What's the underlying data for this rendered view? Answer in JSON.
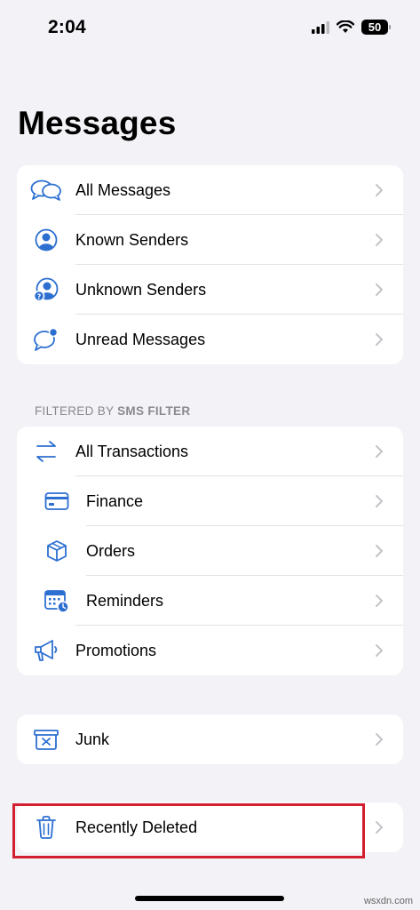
{
  "status_bar": {
    "time": "2:04",
    "battery": "50",
    "icons": [
      "signal-icon",
      "wifi-icon",
      "battery-icon"
    ]
  },
  "page_title": "Messages",
  "main_list": {
    "items": [
      {
        "label": "All Messages",
        "icon": "speech-bubbles-icon"
      },
      {
        "label": "Known Senders",
        "icon": "person-circle-icon"
      },
      {
        "label": "Unknown Senders",
        "icon": "person-question-icon"
      },
      {
        "label": "Unread Messages",
        "icon": "unread-bubble-icon"
      }
    ]
  },
  "filter_section": {
    "header_prefix": "FILTERED BY ",
    "header_bold": "SMS FILTER",
    "items": [
      {
        "label": "All Transactions",
        "icon": "arrows-left-right-icon"
      },
      {
        "label": "Finance",
        "icon": "credit-card-icon"
      },
      {
        "label": "Orders",
        "icon": "box-icon"
      },
      {
        "label": "Reminders",
        "icon": "calendar-clock-icon"
      },
      {
        "label": "Promotions",
        "icon": "megaphone-icon"
      }
    ]
  },
  "junk": {
    "label": "Junk",
    "icon": "junk-box-icon"
  },
  "recently_deleted": {
    "label": "Recently Deleted",
    "icon": "trash-icon"
  },
  "watermark": "wsxdn.com",
  "colors": {
    "accent": "#2c6fd1",
    "background": "#f2f2f7",
    "highlight": "#d32030"
  }
}
